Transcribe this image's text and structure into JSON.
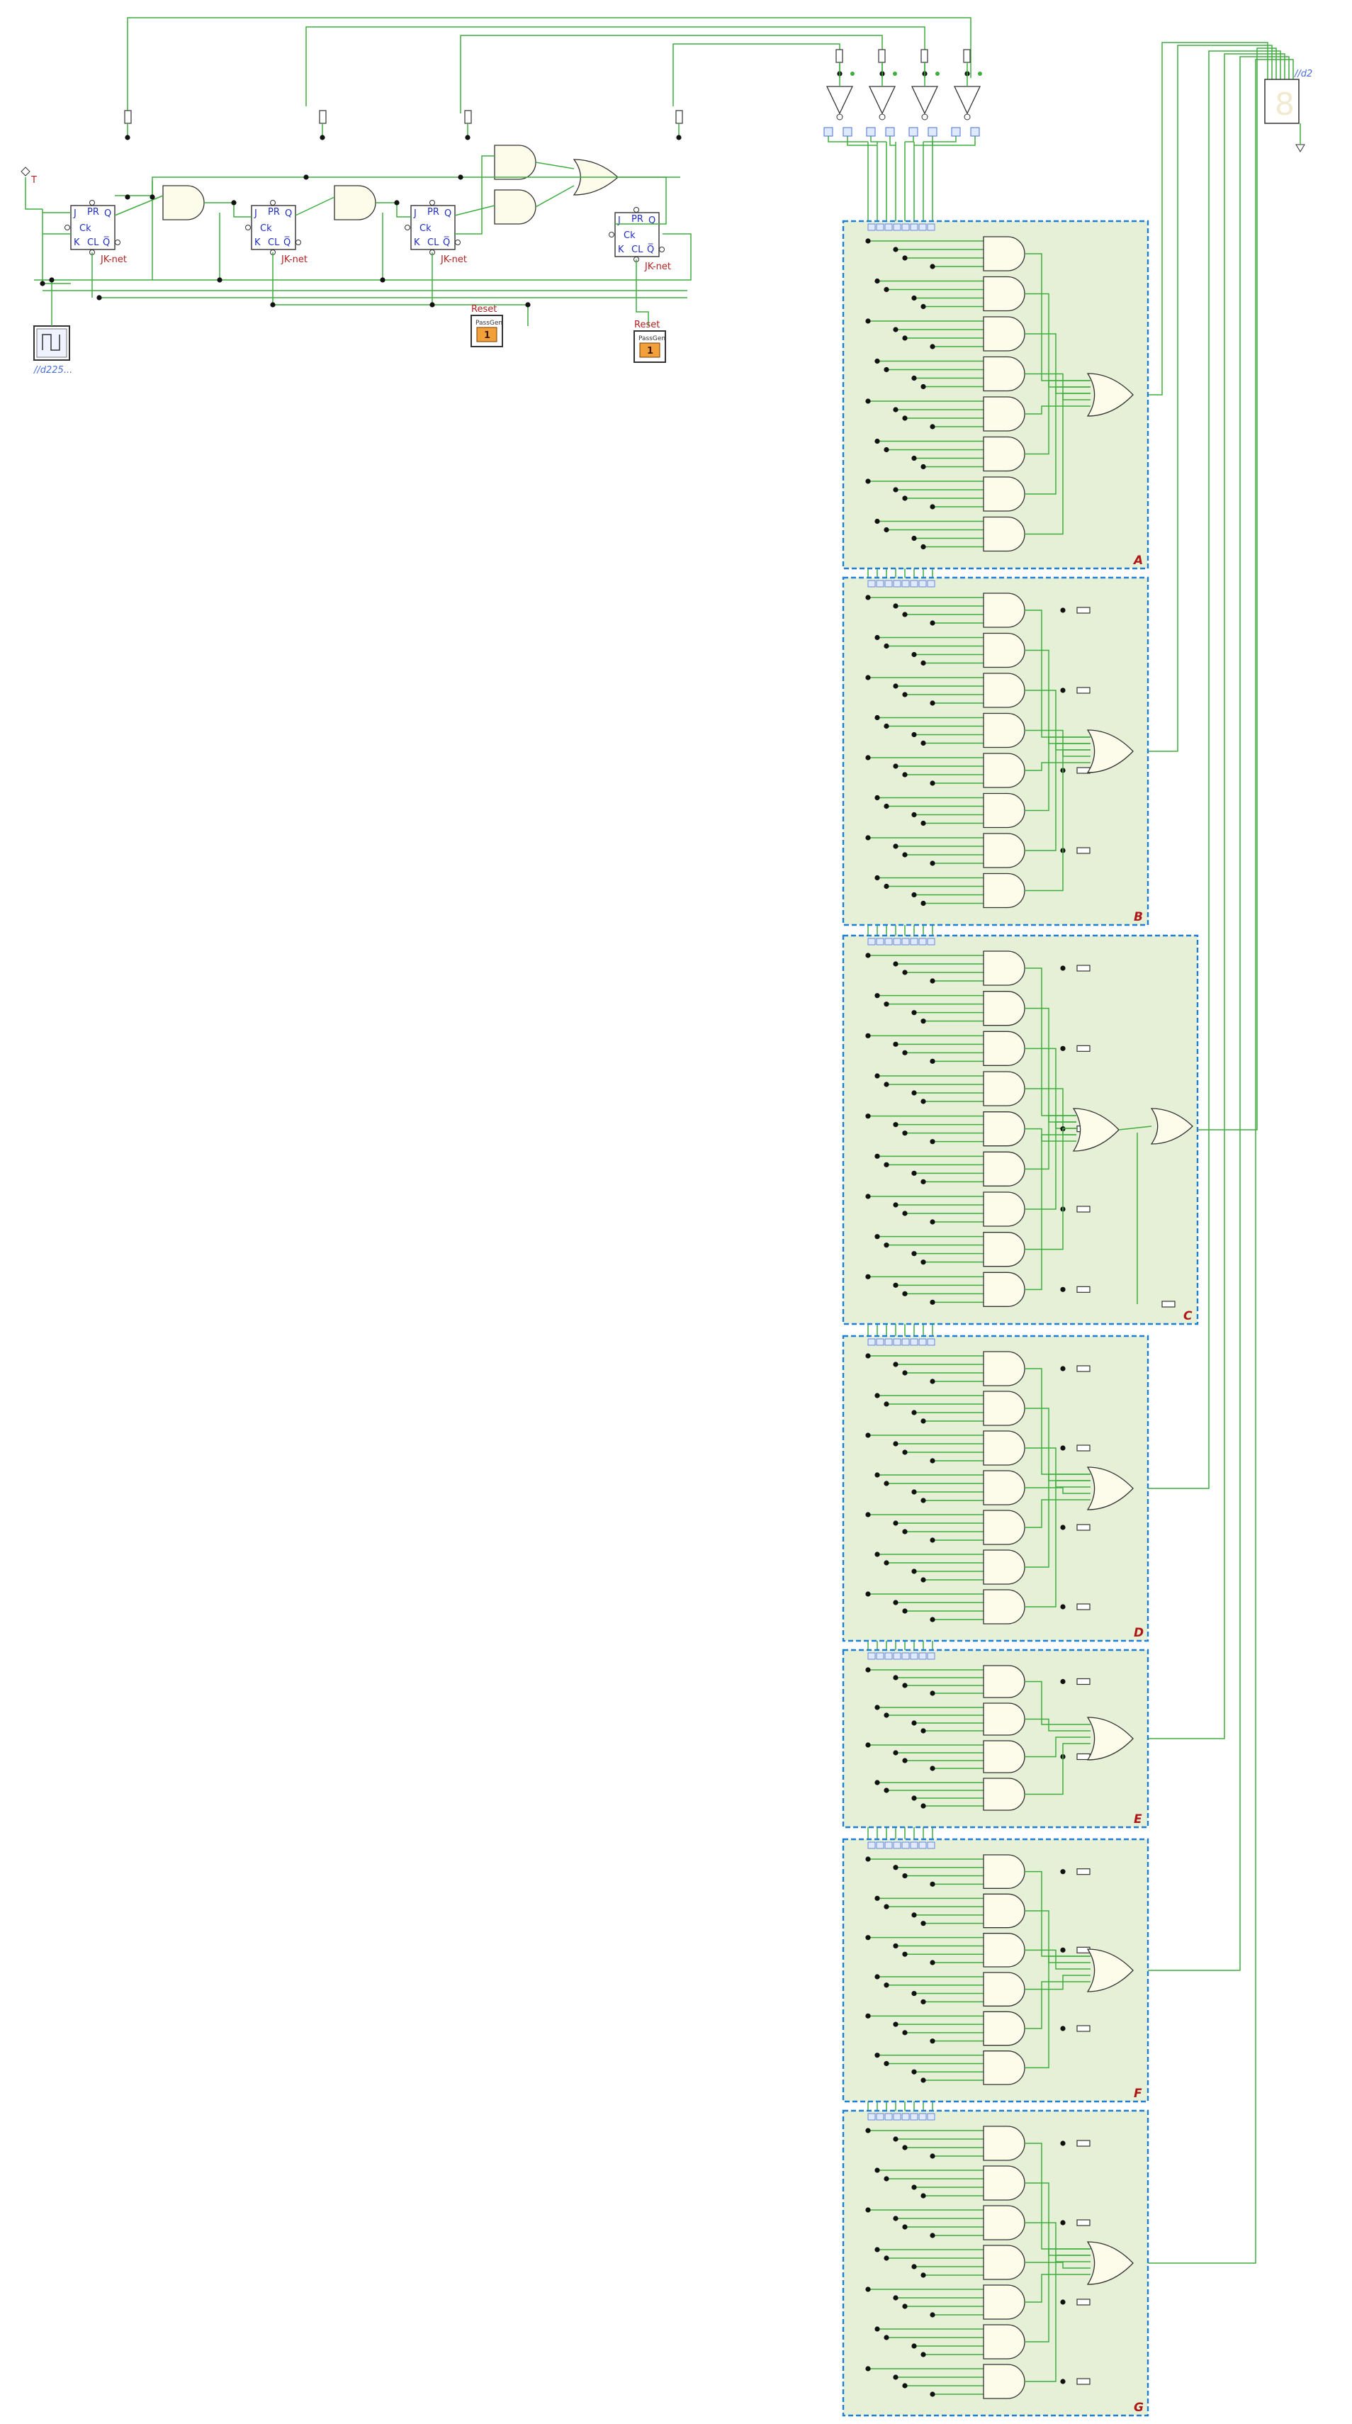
{
  "canvas_label": "",
  "clock": {
    "node_label": "T",
    "generator_label": "//d225..."
  },
  "flip_flops": [
    {
      "id": "ff1",
      "pins": [
        "J",
        "PR",
        "Q",
        "Ck",
        "K",
        "CL",
        "Q̅"
      ],
      "tag": "JK-net"
    },
    {
      "id": "ff2",
      "pins": [
        "J",
        "PR",
        "Q",
        "Ck",
        "K",
        "CL",
        "Q̅"
      ],
      "tag": "JK-net"
    },
    {
      "id": "ff3",
      "pins": [
        "J",
        "PR",
        "Q",
        "Ck",
        "K",
        "CL",
        "Q̅"
      ],
      "tag": "JK-net"
    },
    {
      "id": "ff4",
      "pins": [
        "J",
        "PR",
        "Q",
        "Ck",
        "K",
        "CL",
        "Q̅"
      ],
      "tag": "JK-net"
    }
  ],
  "reset_buttons": [
    {
      "title": "Reset",
      "device": "PassGen",
      "value": "1"
    },
    {
      "title": "Reset",
      "device": "PassGen",
      "value": "1"
    }
  ],
  "display": {
    "label": "//d2",
    "digit": "8"
  },
  "blocks": [
    {
      "letter": "A",
      "gates": 8
    },
    {
      "letter": "B",
      "gates": 8
    },
    {
      "letter": "C",
      "gates": 9
    },
    {
      "letter": "D",
      "gates": 7
    },
    {
      "letter": "E",
      "gates": 4
    },
    {
      "letter": "F",
      "gates": 6
    },
    {
      "letter": "G",
      "gates": 7
    }
  ],
  "colors": {
    "wire": "#3fae3f",
    "block_fill": "#e5f0d6",
    "block_border": "#1f7fd6",
    "gate_fill": "#fdfbe9",
    "block_letter": "#b01818",
    "label_blue": "#4a6fd6"
  }
}
